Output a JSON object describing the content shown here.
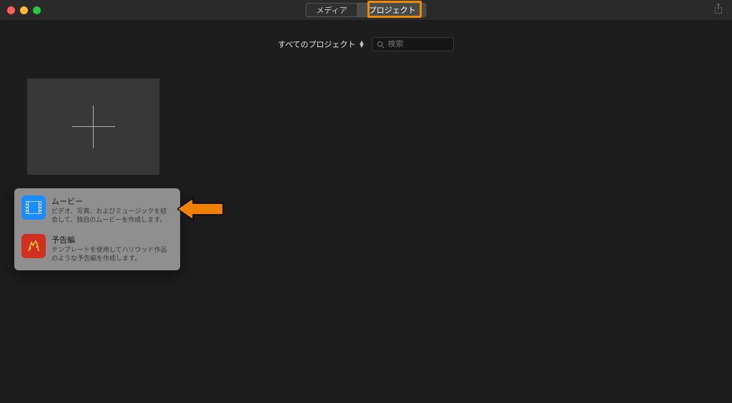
{
  "tabs": {
    "media": "メディア",
    "projects": "プロジェクト"
  },
  "toolbar": {
    "selector_label": "すべてのプロジェクト",
    "search_placeholder": "検索"
  },
  "popover": {
    "movie": {
      "title": "ムービー",
      "desc": "ビデオ、写真、およびミュージックを結合して、独自のムービーを作成します。"
    },
    "trailer": {
      "title": "予告編",
      "desc": "テンプレートを使用してハリウッド作品のような予告編を作成します。"
    }
  }
}
